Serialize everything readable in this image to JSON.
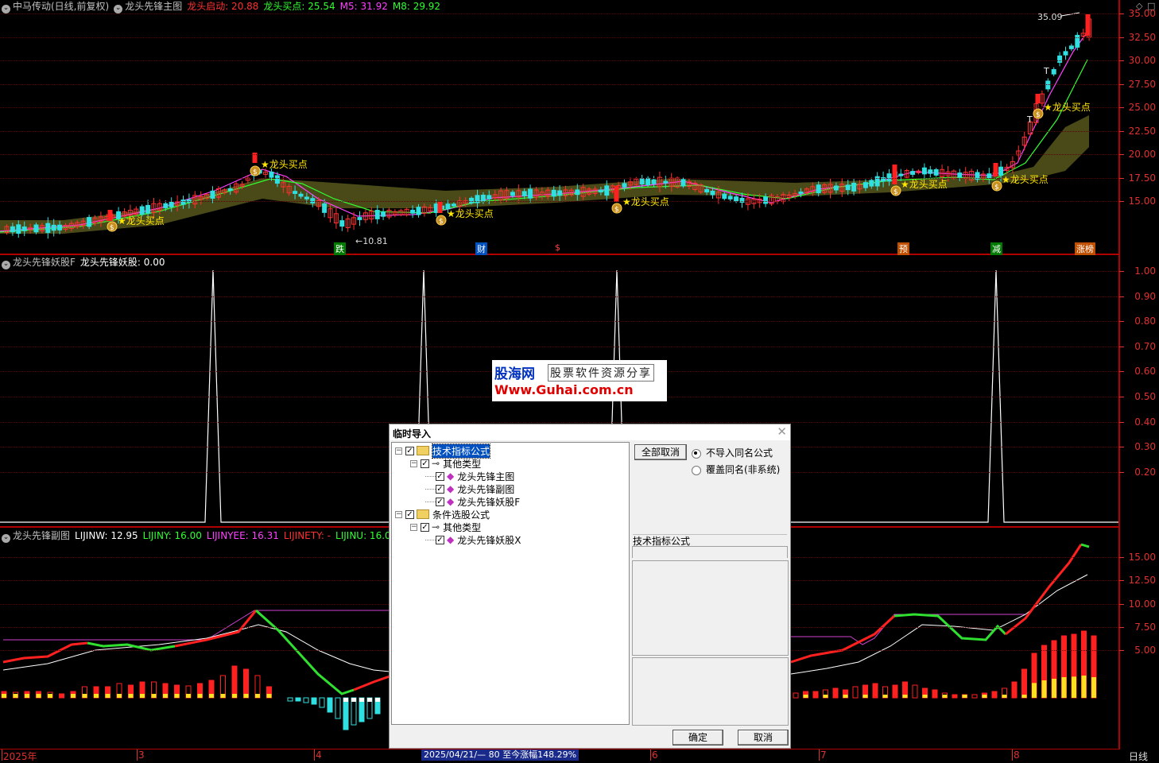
{
  "main_pane": {
    "title_items": [
      {
        "text": "中马传动(日线,前复权)",
        "color": "#c0c0c0"
      },
      {
        "text": "龙头先锋主图",
        "color": "#c0c0c0"
      },
      {
        "text": "龙头启动: 20.88",
        "color": "#ff3030"
      },
      {
        "text": "龙头买点: 25.54",
        "color": "#30ff30"
      },
      {
        "text": "M5: 31.92",
        "color": "#ff40ff"
      },
      {
        "text": "M8: 29.92",
        "color": "#30ff30"
      }
    ],
    "y_ticks": [
      "35.00",
      "32.50",
      "30.00",
      "27.50",
      "25.00",
      "22.50",
      "20.00",
      "17.50",
      "15.00"
    ],
    "high_label": "35.09",
    "low_label": "←10.81",
    "buy_signal_label": "★龙头买点",
    "event_tags": [
      {
        "text": "跌",
        "bg": "#007a00"
      },
      {
        "text": "财",
        "bg": "#0050c0"
      },
      {
        "text": "$",
        "bg": "#000000",
        "fg": "#ff4040"
      },
      {
        "text": "预",
        "bg": "#c05000"
      },
      {
        "text": "减",
        "bg": "#007a00"
      },
      {
        "text": "涨榜",
        "bg": "#c05000"
      }
    ],
    "small_t": "T"
  },
  "pane2": {
    "title_items": [
      {
        "text": "龙头先锋妖股F",
        "color": "#c0c0c0"
      },
      {
        "text": "龙头先锋妖股: 0.00",
        "color": "#ffffff"
      }
    ],
    "y_ticks": [
      "1.00",
      "0.90",
      "0.80",
      "0.70",
      "0.60",
      "0.50",
      "0.40",
      "0.30",
      "0.20"
    ]
  },
  "pane3": {
    "title_items": [
      {
        "text": "龙头先锋副图",
        "color": "#c0c0c0"
      },
      {
        "text": "LIJINW: 12.95",
        "color": "#ffffff"
      },
      {
        "text": "LIJINY: 16.00",
        "color": "#30ff30"
      },
      {
        "text": "LIJINYEE: 16.31",
        "color": "#ff40ff"
      },
      {
        "text": "LIJINETY: -",
        "color": "#ff3030"
      },
      {
        "text": "LIJINU: 16.00",
        "color": "#30ff30"
      }
    ],
    "y_ticks": [
      "15.00",
      "12.50",
      "10.00",
      "7.50",
      "5.00"
    ]
  },
  "bottom_bar": {
    "dates": [
      "2025年",
      "3",
      "4",
      "6",
      "7",
      "8"
    ],
    "status": "2025/04/21/— 80 至今涨幅148.29%",
    "period": "日线"
  },
  "watermark": {
    "brand": "股海网",
    "slogan": "股票软件资源分享",
    "url": "Www.Guhai.com.cn"
  },
  "dialog": {
    "title": "临时导入",
    "tree": [
      {
        "label": "技术指标公式",
        "level": 0,
        "type": "folder",
        "selected": true
      },
      {
        "label": "其他类型",
        "level": 1,
        "type": "group"
      },
      {
        "label": "龙头先锋主图",
        "level": 2,
        "type": "item"
      },
      {
        "label": "龙头先锋副图",
        "level": 2,
        "type": "item"
      },
      {
        "label": "龙头先锋妖股F",
        "level": 2,
        "type": "item"
      },
      {
        "label": "条件选股公式",
        "level": 0,
        "type": "folder"
      },
      {
        "label": "其他类型",
        "level": 1,
        "type": "group"
      },
      {
        "label": "龙头先锋妖股X",
        "level": 2,
        "type": "item"
      }
    ],
    "deselect_all": "全部取消",
    "radio_options": [
      {
        "label": "不导入同名公式",
        "checked": true
      },
      {
        "label": "覆盖同名(非系统)",
        "checked": false
      }
    ],
    "info_label": "技术指标公式",
    "ok": "确定",
    "cancel": "取消"
  }
}
